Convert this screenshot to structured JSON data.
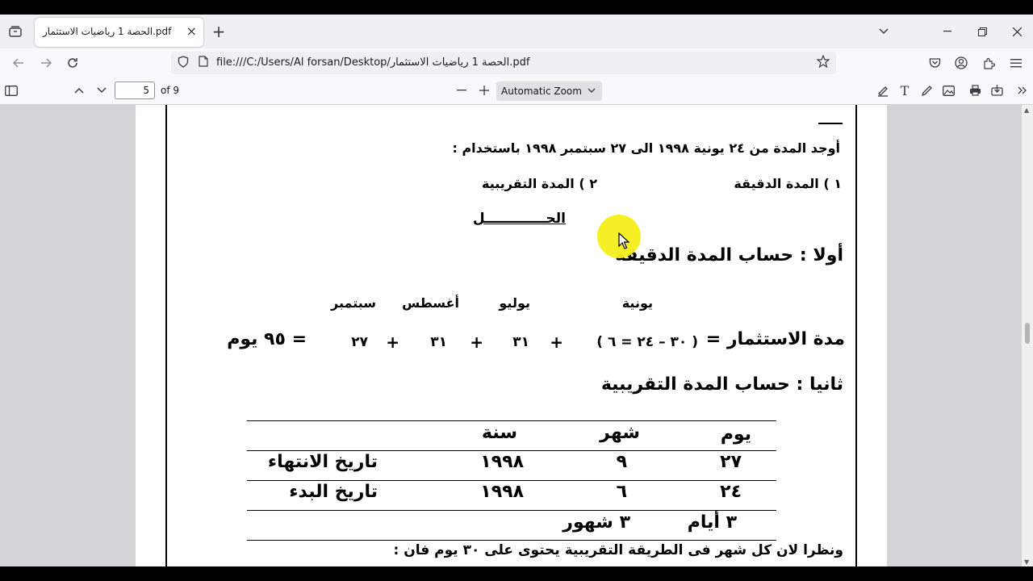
{
  "browser": {
    "tab_title": "الحصة 1 رياضيات الاستثمار.pdf",
    "url": "file:///C:/Users/Al forsan/Desktop/الحصة 1 رياضيات الاستثمار.pdf"
  },
  "pdf_toolbar": {
    "page_number": "5",
    "page_count": "of 9",
    "zoom": "Automatic Zoom"
  },
  "document": {
    "question": "أوجد المدة من ٢٤ يونية ١٩٩٨ الى ٢٧ سبتمبر ١٩٩٨ باستخدام :",
    "option1": "١ ) المدة الدقيقة",
    "option2": "٢ ) المدة التقريبية",
    "solution_title": "الحـــــــــــــل",
    "section1_title": "أولا : حساب المدة الدقيقة",
    "months": [
      "يونية",
      "يوليو",
      "أغسطس",
      "سبتمبر"
    ],
    "duration_label": "مدة الاستثمار =",
    "duration_terms": [
      "( ٣٠ – ٢٤ = ٦ )",
      "+",
      "٣١",
      "+",
      "٣١",
      "+",
      "٢٧"
    ],
    "duration_result": "= ٩٥ يوم",
    "section2_title": "ثانيا : حساب المدة التقريبية",
    "table": {
      "headers": [
        "يوم",
        "شهر",
        "سنة"
      ],
      "rows": [
        {
          "day": "٢٧",
          "month": "٩",
          "year": "١٩٩٨",
          "label": "تاريخ الانتهاء"
        },
        {
          "day": "٢٤",
          "month": "٦",
          "year": "١٩٩٨",
          "label": "تاريخ البدء"
        }
      ],
      "diff_days": "٣ أيام",
      "diff_months": "٣ شهور"
    },
    "footnote": "ونظرا لان كل شهر فى الطريقة التقريبية يحتوى على ٣٠ يوم فان :"
  }
}
